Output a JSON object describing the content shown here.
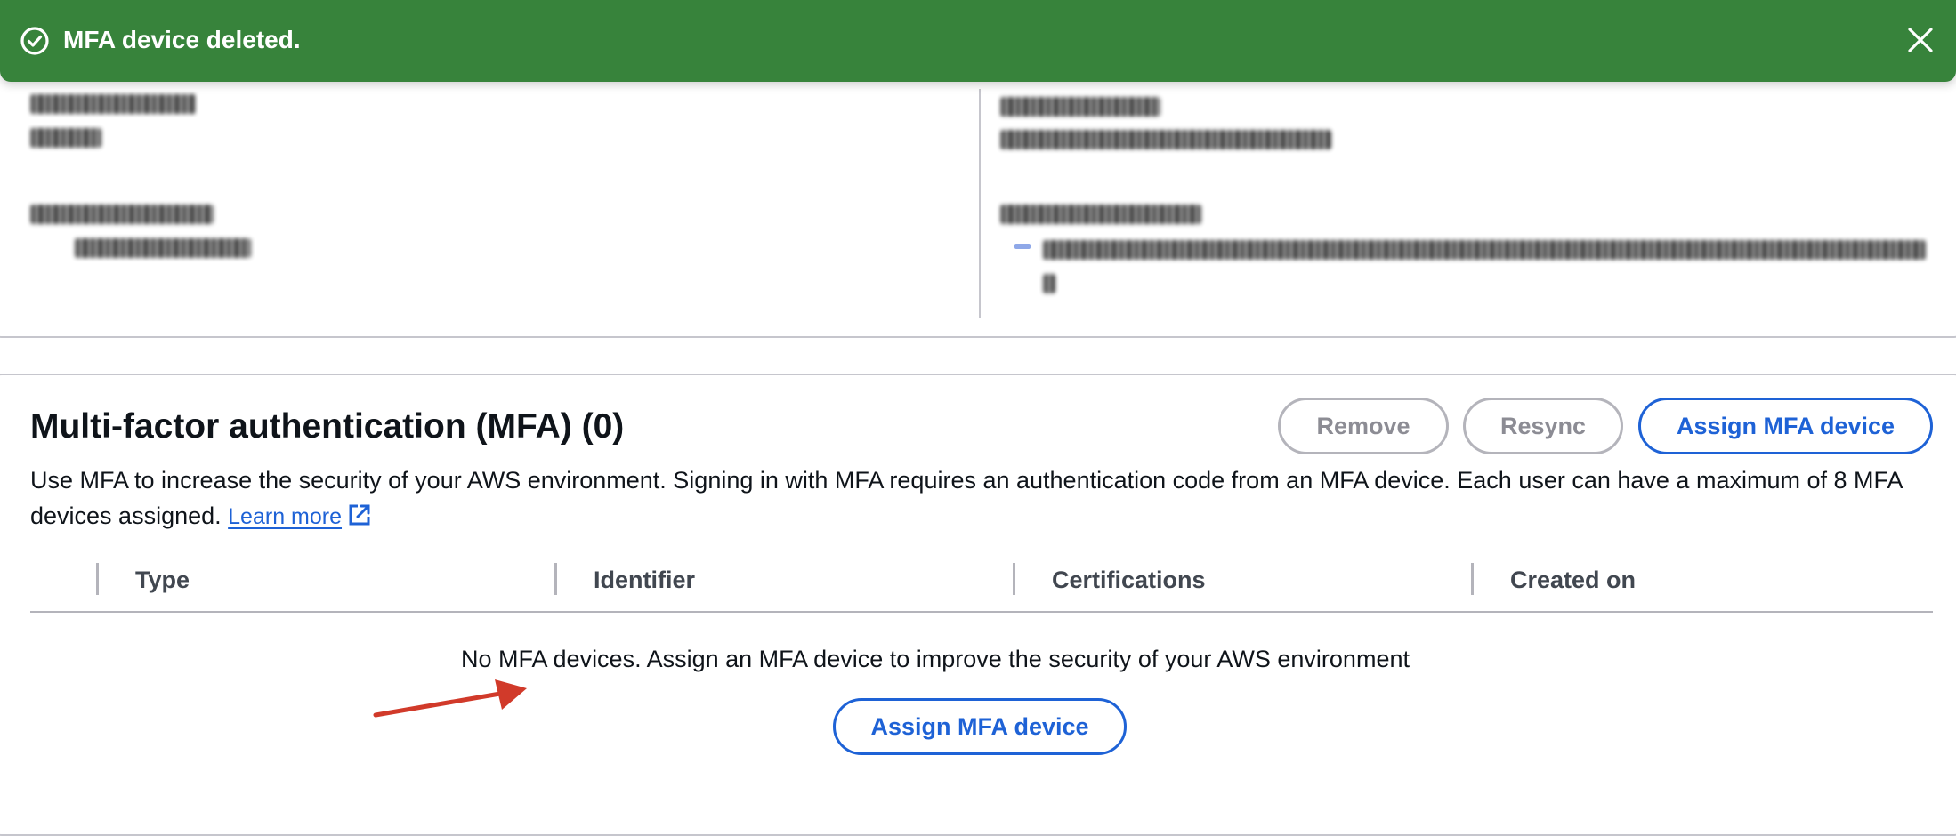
{
  "flash": {
    "message": "MFA device deleted.",
    "status_icon": "success-check-circle-icon",
    "close_icon": "close-icon",
    "background_color": "#37833b"
  },
  "mfa": {
    "title": "Multi-factor authentication (MFA) (0)",
    "buttons": {
      "remove": "Remove",
      "resync": "Resync",
      "assign": "Assign MFA device"
    },
    "description": "Use MFA to increase the security of your AWS environment. Signing in with MFA requires an authentication code from an MFA device. Each user can have a maximum of 8 MFA devices assigned.",
    "learn_more": "Learn more",
    "table": {
      "columns": [
        "Type",
        "Identifier",
        "Certifications",
        "Created on"
      ],
      "rows": []
    },
    "empty_message": "No MFA devices. Assign an MFA device to improve the security of your AWS environment",
    "empty_action": "Assign MFA device"
  },
  "colors": {
    "primary_blue": "#1e62d6",
    "annotation_red": "#d13a2a",
    "border_gray": "#c6c6cd"
  }
}
